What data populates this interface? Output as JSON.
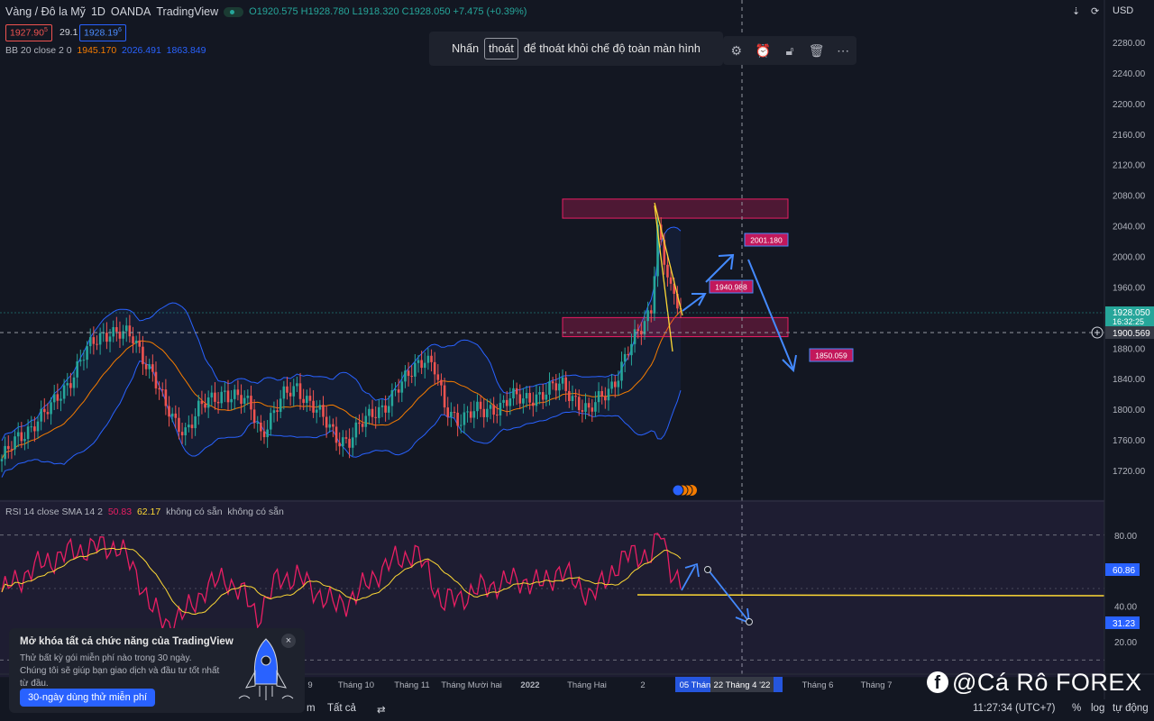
{
  "header": {
    "symbol": "Vàng / Đô la Mỹ",
    "interval": "1D",
    "broker": "OANDA",
    "platform": "TradingView",
    "open": "O1920.575",
    "high": "H1928.780",
    "low": "L1918.320",
    "close": "C1928.050",
    "change": "+7.475 (+0.39%)",
    "sell_price": "1927.90",
    "sell_sup": "5",
    "spread": "29.1",
    "buy_price": "1928.19",
    "buy_sup": "6",
    "currency": "USD"
  },
  "bb_indicator": {
    "label": "BB 20 close 2 0",
    "basis": "1945.170",
    "upper": "2026.491",
    "lower": "1863.849"
  },
  "rsi_indicator": {
    "label": "RSI 14 close SMA 14 2",
    "rsi": "50.83",
    "sma": "62.17",
    "na1": "không có sẵn",
    "na2": "không có sẵn"
  },
  "toast": {
    "prefix": "Nhấn",
    "key": "thoát",
    "suffix": "để thoát khỏi chế độ toàn màn hình"
  },
  "toolbar_icons": [
    "gear-icon",
    "alert-icon",
    "lock-icon",
    "trash-icon",
    "more-icon"
  ],
  "promo": {
    "title": "Mở khóa tất cả chức năng của TradingView",
    "desc": "Thử bất kỳ gói miễn phí nào trong 30 ngày. Chúng tôi sẽ giúp bạn giao dịch và đầu tư tốt nhất từ đầu.",
    "button": "30-ngày dùng thử miễn phí"
  },
  "bottom_bar": {
    "range_label": "Tất cả",
    "time": "11:27:34 (UTC+7)",
    "percent": "%",
    "log": "log",
    "auto": "tự động"
  },
  "watermark": "@Cá Rô FOREX",
  "chart_data": {
    "type": "candlestick",
    "price_axis": {
      "min": 1700,
      "max": 2290,
      "ticks": [
        2280,
        2240,
        2200,
        2160,
        2120,
        2080,
        2040,
        2000,
        1960,
        1920,
        1880,
        1840,
        1800,
        1760,
        1720
      ],
      "last_price": "1928.050",
      "countdown": "16:32:25",
      "crosshair_price": "1900.569"
    },
    "rsi_axis": {
      "ticks": [
        80,
        40,
        20
      ],
      "rsi_value": "60.86",
      "cursor_value": "31.23",
      "bands": [
        70,
        30
      ]
    },
    "time_axis": {
      "labels": [
        "9",
        "Tháng 10",
        "Tháng 11",
        "Tháng Mười hai",
        "2022",
        "Tháng Hai",
        "2",
        "Tháng 6",
        "Tháng 7"
      ],
      "highlight_left": "05 Thán",
      "highlight_center": "22 Tháng 4 '22"
    },
    "price_series": [
      {
        "i": 0,
        "c": 1735
      },
      {
        "i": 5,
        "c": 1760
      },
      {
        "i": 10,
        "c": 1785
      },
      {
        "i": 15,
        "c": 1800
      },
      {
        "i": 20,
        "c": 1835
      },
      {
        "i": 25,
        "c": 1870
      },
      {
        "i": 30,
        "c": 1895
      },
      {
        "i": 33,
        "c": 1905
      },
      {
        "i": 36,
        "c": 1900
      },
      {
        "i": 40,
        "c": 1890
      },
      {
        "i": 43,
        "c": 1870
      },
      {
        "i": 46,
        "c": 1850
      },
      {
        "i": 50,
        "c": 1800
      },
      {
        "i": 53,
        "c": 1780
      },
      {
        "i": 56,
        "c": 1775
      },
      {
        "i": 60,
        "c": 1800
      },
      {
        "i": 64,
        "c": 1810
      },
      {
        "i": 68,
        "c": 1825
      },
      {
        "i": 72,
        "c": 1815
      },
      {
        "i": 76,
        "c": 1800
      },
      {
        "i": 79,
        "c": 1770
      },
      {
        "i": 82,
        "c": 1790
      },
      {
        "i": 86,
        "c": 1815
      },
      {
        "i": 90,
        "c": 1830
      },
      {
        "i": 94,
        "c": 1810
      },
      {
        "i": 98,
        "c": 1785
      },
      {
        "i": 102,
        "c": 1765
      },
      {
        "i": 106,
        "c": 1760
      },
      {
        "i": 110,
        "c": 1780
      },
      {
        "i": 114,
        "c": 1800
      },
      {
        "i": 118,
        "c": 1810
      },
      {
        "i": 122,
        "c": 1830
      },
      {
        "i": 126,
        "c": 1860
      },
      {
        "i": 129,
        "c": 1870
      },
      {
        "i": 132,
        "c": 1850
      },
      {
        "i": 135,
        "c": 1800
      },
      {
        "i": 139,
        "c": 1790
      },
      {
        "i": 143,
        "c": 1795
      },
      {
        "i": 147,
        "c": 1795
      },
      {
        "i": 151,
        "c": 1805
      },
      {
        "i": 155,
        "c": 1815
      },
      {
        "i": 159,
        "c": 1810
      },
      {
        "i": 163,
        "c": 1820
      },
      {
        "i": 167,
        "c": 1825
      },
      {
        "i": 171,
        "c": 1830
      },
      {
        "i": 175,
        "c": 1815
      },
      {
        "i": 179,
        "c": 1795
      },
      {
        "i": 183,
        "c": 1815
      },
      {
        "i": 187,
        "c": 1840
      },
      {
        "i": 191,
        "c": 1875
      },
      {
        "i": 195,
        "c": 1905
      },
      {
        "i": 198,
        "c": 1935
      },
      {
        "i": 200,
        "c": 2040
      },
      {
        "i": 202,
        "c": 1995
      },
      {
        "i": 204,
        "c": 1950
      },
      {
        "i": 207,
        "c": 1930
      }
    ],
    "zones": [
      {
        "name": "resistance",
        "from": 2050,
        "to": 2075
      },
      {
        "name": "support",
        "from": 1895,
        "to": 1920
      }
    ],
    "annotations": [
      "1940.988",
      "2001.180",
      "1850.059"
    ],
    "rsi_series": [
      {
        "i": 0,
        "v": 48
      },
      {
        "i": 10,
        "v": 62
      },
      {
        "i": 20,
        "v": 70
      },
      {
        "i": 30,
        "v": 74
      },
      {
        "i": 36,
        "v": 73
      },
      {
        "i": 42,
        "v": 55
      },
      {
        "i": 46,
        "v": 38
      },
      {
        "i": 50,
        "v": 30
      },
      {
        "i": 56,
        "v": 36
      },
      {
        "i": 62,
        "v": 50
      },
      {
        "i": 68,
        "v": 56
      },
      {
        "i": 74,
        "v": 46
      },
      {
        "i": 78,
        "v": 34
      },
      {
        "i": 84,
        "v": 55
      },
      {
        "i": 90,
        "v": 57
      },
      {
        "i": 96,
        "v": 48
      },
      {
        "i": 102,
        "v": 40
      },
      {
        "i": 108,
        "v": 46
      },
      {
        "i": 114,
        "v": 58
      },
      {
        "i": 120,
        "v": 66
      },
      {
        "i": 126,
        "v": 70
      },
      {
        "i": 130,
        "v": 60
      },
      {
        "i": 134,
        "v": 42
      },
      {
        "i": 140,
        "v": 45
      },
      {
        "i": 146,
        "v": 50
      },
      {
        "i": 152,
        "v": 53
      },
      {
        "i": 158,
        "v": 55
      },
      {
        "i": 164,
        "v": 52
      },
      {
        "i": 170,
        "v": 60
      },
      {
        "i": 176,
        "v": 52
      },
      {
        "i": 180,
        "v": 45
      },
      {
        "i": 186,
        "v": 60
      },
      {
        "i": 192,
        "v": 70
      },
      {
        "i": 198,
        "v": 68
      },
      {
        "i": 201,
        "v": 82
      },
      {
        "i": 204,
        "v": 62
      },
      {
        "i": 207,
        "v": 52
      }
    ]
  }
}
